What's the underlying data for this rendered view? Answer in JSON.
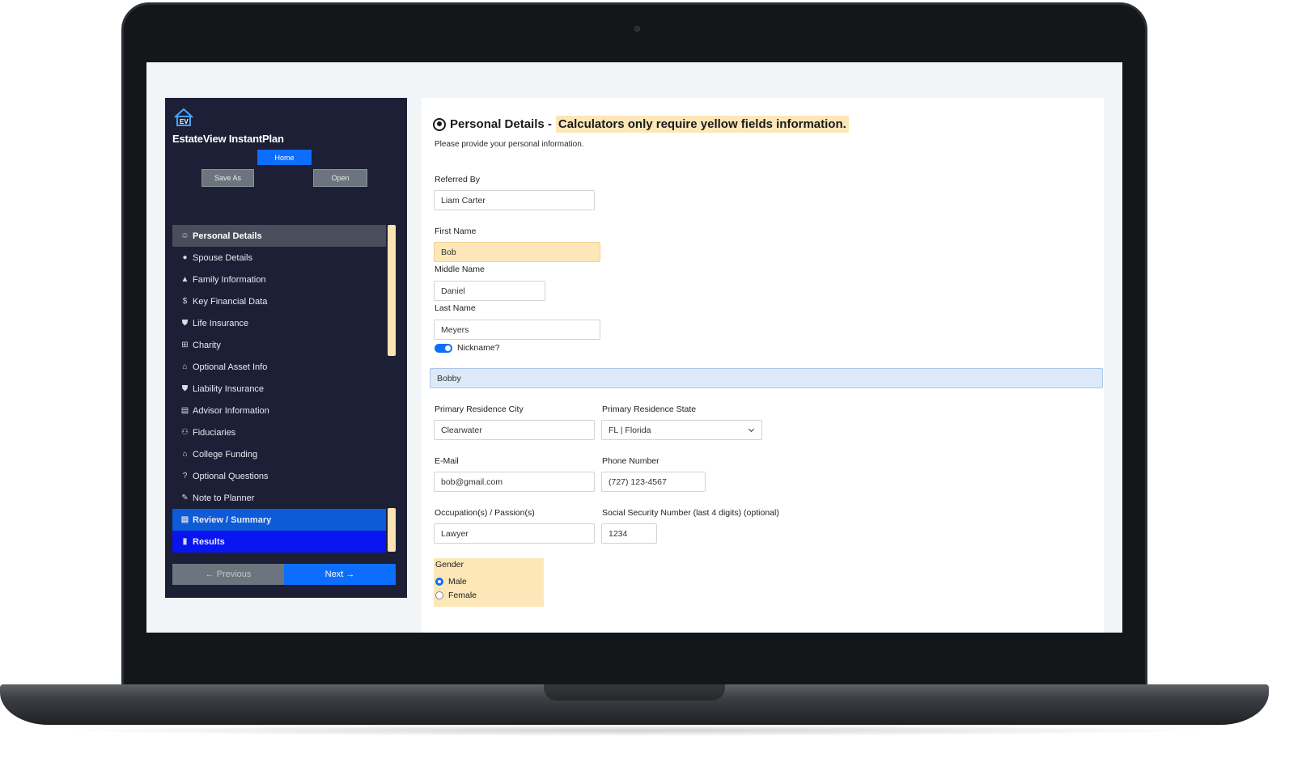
{
  "app": {
    "title": "EstateView InstantPlan",
    "home_label": "Home",
    "save_as_label": "Save As",
    "open_label": "Open",
    "prev_label": "← Previous",
    "next_label": "Next →"
  },
  "sidebar": {
    "items": [
      {
        "label": "Personal Details",
        "icon": "user-circle-icon",
        "glyph": "☺"
      },
      {
        "label": "Spouse Details",
        "icon": "person-icon",
        "glyph": "👤"
      },
      {
        "label": "Family Information",
        "icon": "tree-icon",
        "glyph": "▲"
      },
      {
        "label": "Key Financial Data",
        "icon": "dollar-icon",
        "glyph": "$"
      },
      {
        "label": "Life Insurance",
        "icon": "shield-icon",
        "glyph": "⛊"
      },
      {
        "label": "Charity",
        "icon": "gift-icon",
        "glyph": "⊞"
      },
      {
        "label": "Optional Asset Info",
        "icon": "bank-icon",
        "glyph": "⌂"
      },
      {
        "label": "Liability Insurance",
        "icon": "shield-icon",
        "glyph": "⛊"
      },
      {
        "label": "Advisor Information",
        "icon": "id-card-icon",
        "glyph": "▤"
      },
      {
        "label": "Fiduciaries",
        "icon": "people-icon",
        "glyph": "⚇"
      },
      {
        "label": "College Funding",
        "icon": "graduation-cap-icon",
        "glyph": "⌂"
      },
      {
        "label": "Optional Questions",
        "icon": "question-icon",
        "glyph": "?"
      },
      {
        "label": "Note to Planner",
        "icon": "pencil-square-icon",
        "glyph": "✎"
      },
      {
        "label": "Review / Summary",
        "icon": "document-icon",
        "glyph": "▤"
      },
      {
        "label": "Results",
        "icon": "bar-chart-icon",
        "glyph": "▮"
      }
    ]
  },
  "main": {
    "title": "Personal Details -",
    "note": "Calculators only require yellow fields information.",
    "subtitle": "Please provide your personal information.",
    "referred_by": {
      "label": "Referred By",
      "value": "Liam Carter"
    },
    "first_name": {
      "label": "First Name",
      "value": "Bob"
    },
    "middle_name": {
      "label": "Middle Name",
      "value": "Daniel"
    },
    "last_name": {
      "label": "Last Name",
      "value": "Meyers"
    },
    "nickname_toggle": {
      "label": "Nickname?",
      "value": "Bobby"
    },
    "city": {
      "label": "Primary Residence City",
      "value": "Clearwater"
    },
    "state": {
      "label": "Primary Residence State",
      "value": "FL | Florida"
    },
    "email": {
      "label": "E-Mail",
      "value": "bob@gmail.com"
    },
    "phone": {
      "label": "Phone Number",
      "value": "(727) 123-4567"
    },
    "occupation": {
      "label": "Occupation(s) / Passion(s)",
      "value": "Lawyer"
    },
    "ssn": {
      "label": "Social Security Number (last 4 digits) (optional)",
      "value": "1234"
    },
    "gender": {
      "label": "Gender",
      "options": [
        "Male",
        "Female"
      ],
      "selected": "Male"
    }
  },
  "colors": {
    "sidebar_bg": "#1c1f36",
    "primary": "#0d6efd",
    "required_yellow": "#fde7b8",
    "results_blue": "#0a14f0"
  }
}
